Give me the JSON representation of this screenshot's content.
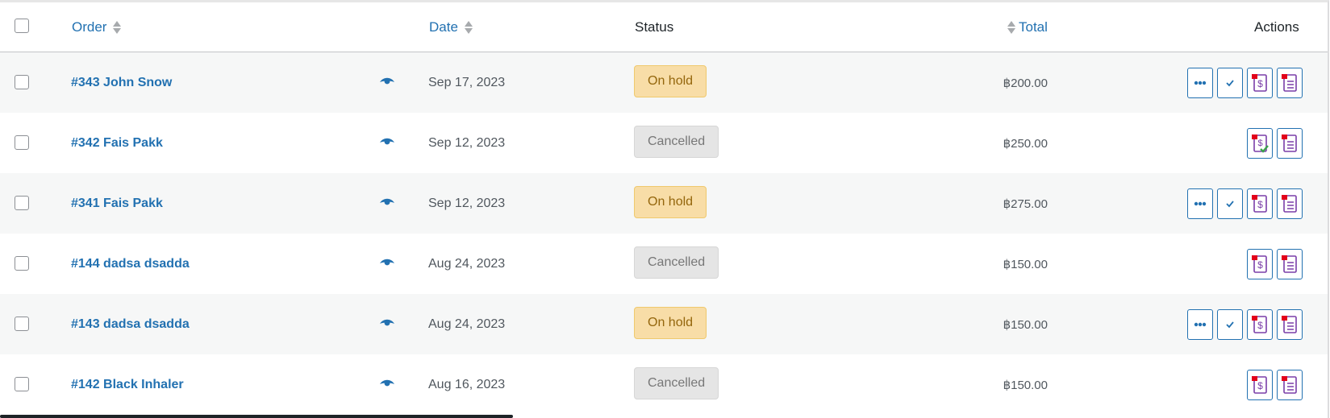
{
  "header": {
    "order_label": "Order",
    "date_label": "Date",
    "status_label": "Status",
    "total_label": "Total",
    "actions_label": "Actions"
  },
  "rows": [
    {
      "order": "#343 John Snow",
      "date": "Sep 17, 2023",
      "status": "On hold",
      "total": "฿200.00",
      "status_type": "hold"
    },
    {
      "order": "#342 Fais Pakk",
      "date": "Sep 12, 2023",
      "status": "Cancelled",
      "total": "฿250.00",
      "status_type": "cancel"
    },
    {
      "order": "#341 Fais Pakk",
      "date": "Sep 12, 2023",
      "status": "On hold",
      "total": "฿275.00",
      "status_type": "hold"
    },
    {
      "order": "#144 dadsa dsadda",
      "date": "Aug 24, 2023",
      "status": "Cancelled",
      "total": "฿150.00",
      "status_type": "cancel"
    },
    {
      "order": "#143 dadsa dsadda",
      "date": "Aug 24, 2023",
      "status": "On hold",
      "total": "฿150.00",
      "status_type": "hold"
    },
    {
      "order": "#142 Black Inhaler",
      "date": "Aug 16, 2023",
      "status": "Cancelled",
      "total": "฿150.00",
      "status_type": "cancel"
    }
  ],
  "icons": {
    "preview": "eye-icon",
    "more": "ellipsis-icon",
    "complete": "checkmark-icon",
    "invoice": "invoice-pdf-icon",
    "packing_slip": "packing-slip-pdf-icon"
  },
  "colors": {
    "link": "#2271b1",
    "hold_bg": "#f8dda7",
    "hold_text": "#94660c",
    "cancel_bg": "#e5e5e5",
    "cancel_text": "#777777",
    "pdf_red": "#e2001a",
    "pdf_purple": "#7a3ea8",
    "paid_green": "#3aa34b"
  }
}
